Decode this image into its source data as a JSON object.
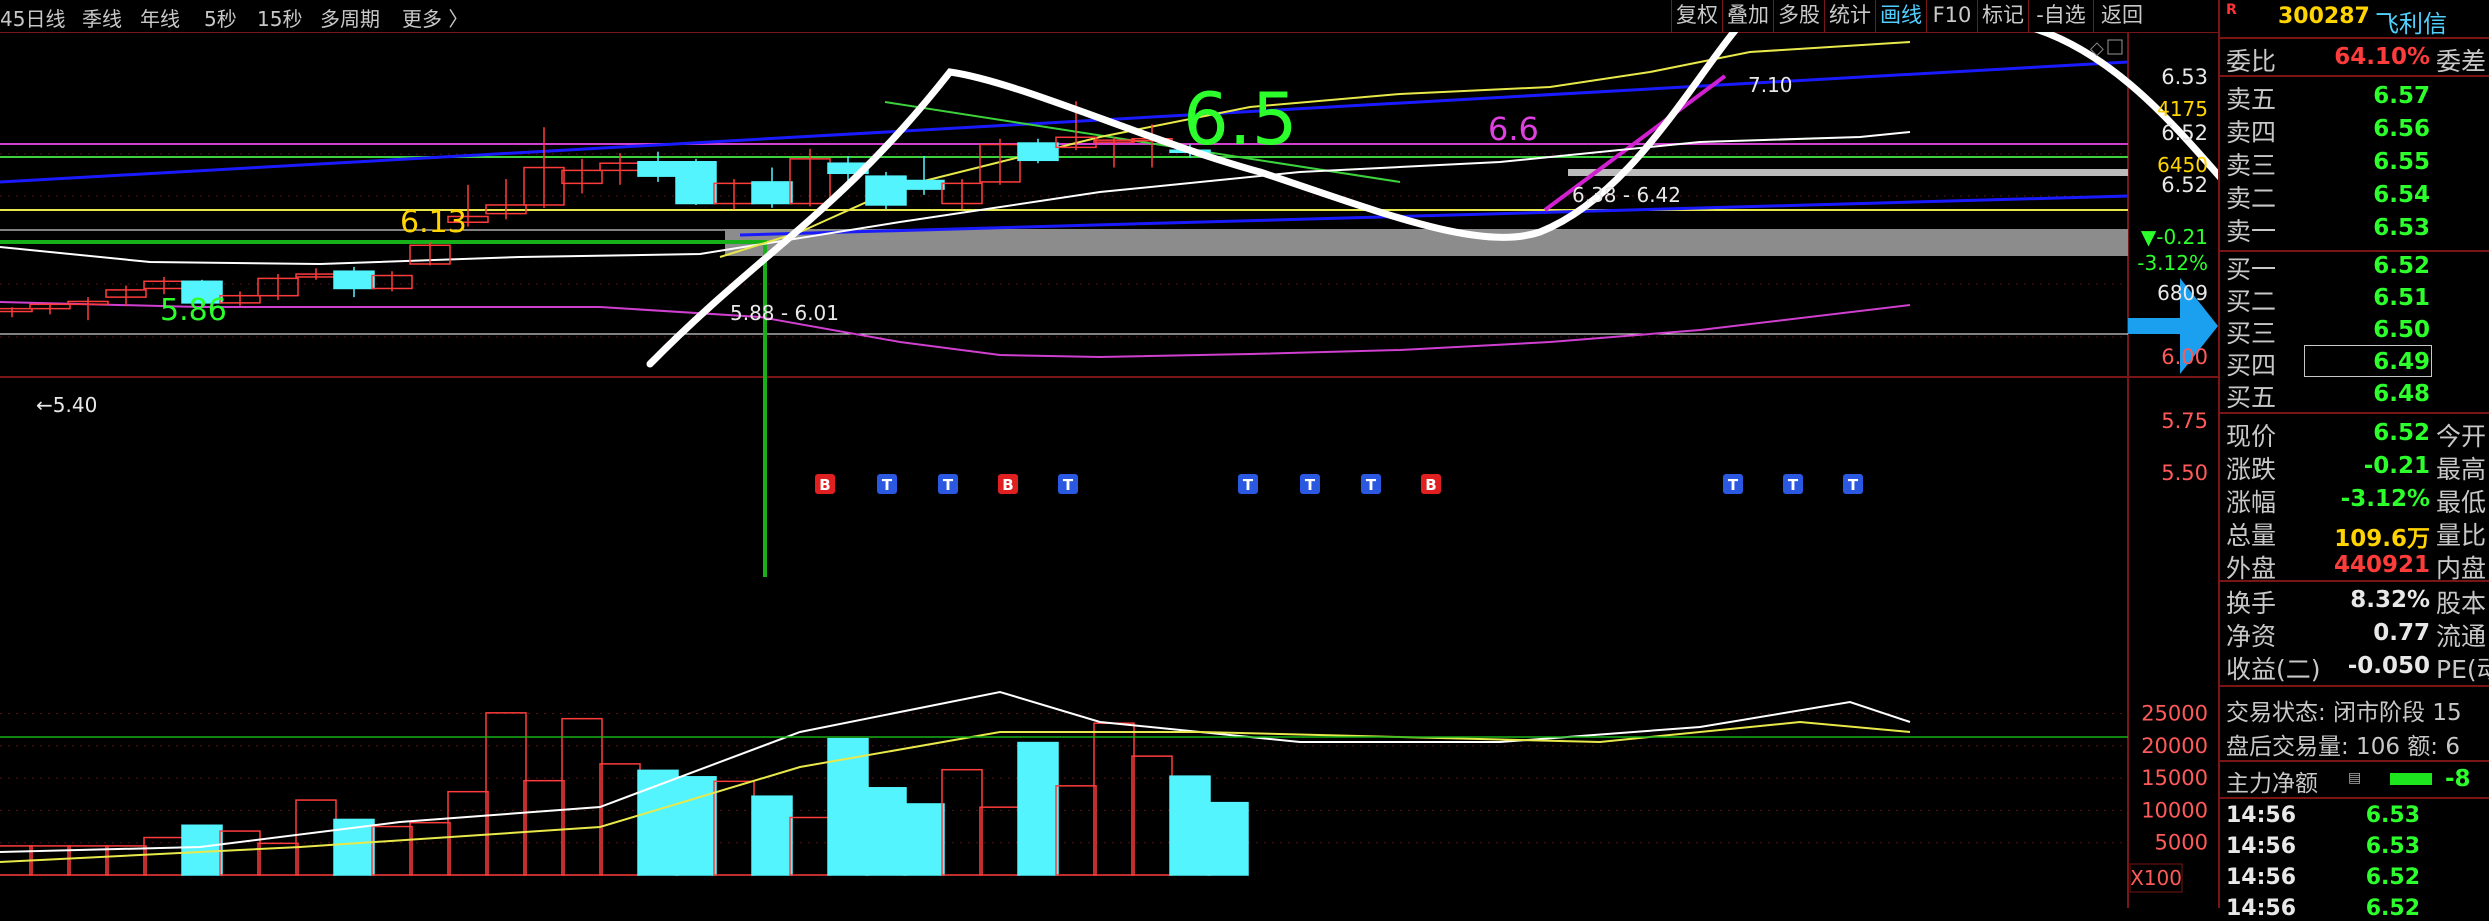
{
  "toolbar": {
    "periods": [
      "45日线",
      "季线",
      "年线",
      "5秒",
      "15秒",
      "多周期",
      "更多 〉"
    ],
    "tools": [
      "复权",
      "叠加",
      "多股",
      "统计",
      "画线",
      "F10",
      "标记",
      "-自选",
      "返回"
    ],
    "active_tool": "画线"
  },
  "stock": {
    "r_mark": "R",
    "code": "300287",
    "name": "飞利信"
  },
  "quote": {
    "weibi": {
      "label": "委比",
      "value": "64.10%",
      "label2": "委差"
    },
    "asks": [
      {
        "label": "卖五",
        "price": "6.57"
      },
      {
        "label": "卖四",
        "price": "6.56"
      },
      {
        "label": "卖三",
        "price": "6.55"
      },
      {
        "label": "卖二",
        "price": "6.54"
      },
      {
        "label": "卖一",
        "price": "6.53"
      }
    ],
    "bids": [
      {
        "label": "买一",
        "price": "6.52"
      },
      {
        "label": "买二",
        "price": "6.51"
      },
      {
        "label": "买三",
        "price": "6.50"
      },
      {
        "label": "买四",
        "price": "6.49"
      },
      {
        "label": "买五",
        "price": "6.48"
      }
    ],
    "stats": [
      {
        "label": "现价",
        "value": "6.52",
        "color": "grn",
        "label2": "今开"
      },
      {
        "label": "涨跌",
        "value": "-0.21",
        "color": "grn",
        "label2": "最高"
      },
      {
        "label": "涨幅",
        "value": "-3.12%",
        "color": "grn",
        "label2": "最低"
      },
      {
        "label": "总量",
        "value": "109.6万",
        "color": "yel",
        "label2": "量比"
      },
      {
        "label": "外盘",
        "value": "440921",
        "color": "red",
        "label2": "内盘"
      }
    ],
    "finance": [
      {
        "label": "换手",
        "value": "8.32%",
        "label2": "股本"
      },
      {
        "label": "净资",
        "value": "0.77",
        "label2": "流通"
      },
      {
        "label": "收益(二)",
        "value": "-0.050",
        "label2": "PE(动"
      }
    ],
    "trade_status": "交易状态: 闭市阶段 15",
    "after_hours": "盘后交易量: 106  额: 6",
    "main_flow": {
      "label": "主力净额",
      "value": "-8"
    },
    "ticks": [
      {
        "time": "14:56",
        "price": "6.53"
      },
      {
        "time": "14:56",
        "price": "6.53"
      },
      {
        "time": "14:56",
        "price": "6.52"
      },
      {
        "time": "14:56",
        "price": "6.52"
      }
    ]
  },
  "colors": {
    "background": "#000000",
    "up": "#ff3c3c",
    "down": "#54f4ff",
    "ma_white": "#ffffff",
    "ma_yellow": "#e8e84a",
    "ma_magenta": "#d040d0",
    "trend_blue": "#1a1aff",
    "grid_red": "#7a1515"
  },
  "chart_data": [
    {
      "type": "candlestick",
      "title": "",
      "price_ticks": [
        "6.53",
        "6.52",
        "6.52",
        "6.00",
        "5.75",
        "5.50"
      ],
      "side_labels": [
        "4175",
        "6450",
        "▼-0.21",
        "-3.12%",
        "6809"
      ],
      "candles": [
        {
          "o": 5.42,
          "h": 5.45,
          "l": 5.38,
          "c": 5.44
        },
        {
          "o": 5.44,
          "h": 5.48,
          "l": 5.4,
          "c": 5.47
        },
        {
          "o": 5.47,
          "h": 5.52,
          "l": 5.36,
          "c": 5.49
        },
        {
          "o": 5.52,
          "h": 5.6,
          "l": 5.46,
          "c": 5.57
        },
        {
          "o": 5.58,
          "h": 5.66,
          "l": 5.54,
          "c": 5.63
        },
        {
          "o": 5.63,
          "h": 5.64,
          "l": 5.46,
          "c": 5.48
        },
        {
          "o": 5.48,
          "h": 5.56,
          "l": 5.46,
          "c": 5.53
        },
        {
          "o": 5.53,
          "h": 5.68,
          "l": 5.5,
          "c": 5.65
        },
        {
          "o": 5.66,
          "h": 5.72,
          "l": 5.64,
          "c": 5.68
        },
        {
          "o": 5.7,
          "h": 5.73,
          "l": 5.52,
          "c": 5.58
        },
        {
          "o": 5.58,
          "h": 5.7,
          "l": 5.56,
          "c": 5.67
        },
        {
          "o": 5.75,
          "h": 5.9,
          "l": 5.74,
          "c": 5.88
        },
        {
          "o": 6.04,
          "h": 6.3,
          "l": 6.01,
          "c": 6.08
        },
        {
          "o": 6.1,
          "h": 6.34,
          "l": 6.06,
          "c": 6.16
        },
        {
          "o": 6.16,
          "h": 6.7,
          "l": 6.14,
          "c": 6.42
        },
        {
          "o": 6.31,
          "h": 6.48,
          "l": 6.24,
          "c": 6.4
        },
        {
          "o": 6.4,
          "h": 6.52,
          "l": 6.3,
          "c": 6.45
        },
        {
          "o": 6.46,
          "h": 6.53,
          "l": 6.32,
          "c": 6.36
        },
        {
          "o": 6.46,
          "h": 6.48,
          "l": 6.16,
          "c": 6.17
        },
        {
          "o": 6.17,
          "h": 6.34,
          "l": 6.13,
          "c": 6.31
        },
        {
          "o": 6.32,
          "h": 6.42,
          "l": 6.14,
          "c": 6.17
        },
        {
          "o": 6.17,
          "h": 6.55,
          "l": 6.15,
          "c": 6.48
        },
        {
          "o": 6.45,
          "h": 6.5,
          "l": 6.32,
          "c": 6.38
        },
        {
          "o": 6.36,
          "h": 6.39,
          "l": 6.13,
          "c": 6.16
        },
        {
          "o": 6.33,
          "h": 6.5,
          "l": 6.23,
          "c": 6.27
        },
        {
          "o": 6.17,
          "h": 6.34,
          "l": 6.13,
          "c": 6.31
        },
        {
          "o": 6.32,
          "h": 6.62,
          "l": 6.3,
          "c": 6.58
        },
        {
          "o": 6.59,
          "h": 6.62,
          "l": 6.45,
          "c": 6.47
        },
        {
          "o": 6.56,
          "h": 6.88,
          "l": 6.54,
          "c": 6.63
        },
        {
          "o": 6.6,
          "h": 6.63,
          "l": 6.42,
          "c": 6.61
        },
        {
          "o": 6.62,
          "h": 6.72,
          "l": 6.42,
          "c": 6.62
        },
        {
          "o": 6.54,
          "h": 6.58,
          "l": 6.49,
          "c": 6.53
        }
      ],
      "annotations": [
        "6.13",
        "5.86",
        "6.5",
        "6.6",
        "5.40",
        "5.88 - 6.01",
        "6.38 - 6.42",
        "7.10"
      ],
      "signals": [
        "B",
        "T",
        "T",
        "B",
        "T",
        "T",
        "T",
        "T",
        "B",
        "T",
        "T",
        "T"
      ]
    },
    {
      "type": "bar",
      "title": "",
      "ticks": [
        "25000",
        "20000",
        "15000",
        "10000",
        "5000"
      ],
      "multiplier": "X100",
      "values": [
        4500,
        4500,
        4500,
        4500,
        5800,
        7700,
        6800,
        4900,
        11600,
        8600,
        7500,
        8100,
        12900,
        25100,
        14600,
        24200,
        17200,
        16200,
        15200,
        14500,
        12200,
        8900,
        21100,
        13500,
        11000,
        16300,
        10500,
        20500,
        13800,
        23500,
        18400,
        15300,
        11200
      ]
    }
  ]
}
